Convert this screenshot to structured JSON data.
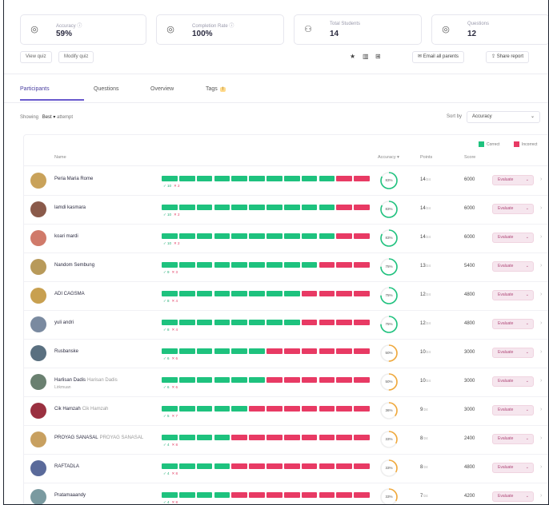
{
  "stats": [
    {
      "icon": "target-icon",
      "glyph": "◎",
      "label": "Accuracy ⓘ",
      "value": "59%"
    },
    {
      "icon": "completion-icon",
      "glyph": "◎",
      "label": "Completion Rate ⓘ",
      "value": "100%"
    },
    {
      "icon": "students-icon",
      "glyph": "⚇",
      "label": "Total Students",
      "value": "14"
    },
    {
      "icon": "questions-icon",
      "glyph": "◎",
      "label": "Questions",
      "value": "12"
    }
  ],
  "toolbar": {
    "chips": [
      "View quiz",
      "Modify quiz"
    ],
    "icons": [
      "★",
      "▥",
      "⊞"
    ],
    "email_button": "✉ Email all parents",
    "share_button": "⇪ Share report"
  },
  "tabs": [
    {
      "label": "Participants",
      "active": true
    },
    {
      "label": "Questions",
      "active": false
    },
    {
      "label": "Overview",
      "active": false
    },
    {
      "label": "Tags",
      "active": false,
      "badge": "!"
    }
  ],
  "filter": {
    "label": "Showing",
    "value": "Best ▾",
    "suffix": "attempt"
  },
  "sort": {
    "label": "Sort by",
    "value": "Accuracy",
    "caret": "⌄"
  },
  "legend": {
    "correct": "Correct",
    "incorrect": "Incorrect",
    "correct_color": "#1ec27e",
    "incorrect_color": "#e83a64"
  },
  "columns": {
    "name": "Name",
    "accuracy": "Accuracy ▾",
    "points": "Points",
    "score": "Score"
  },
  "participants": [
    {
      "name": "Peria Maria Rome",
      "alt": "",
      "sub": "",
      "correct": 10,
      "incorrect": 2,
      "correct_label": "✓ 10",
      "incorrect_label": "✕ 2",
      "accuracy": 83,
      "accuracy_label": "83%",
      "points": "14",
      "score": "6000",
      "avatar": "#c9a25a"
    },
    {
      "name": "lamdi kasmara",
      "alt": "",
      "sub": "",
      "correct": 10,
      "incorrect": 2,
      "correct_label": "✓ 10",
      "incorrect_label": "✕ 2",
      "accuracy": 83,
      "accuracy_label": "83%",
      "points": "14",
      "score": "6000",
      "avatar": "#8a5a4a"
    },
    {
      "name": "koari mardi",
      "alt": "",
      "sub": "",
      "correct": 10,
      "incorrect": 2,
      "correct_label": "✓ 10",
      "incorrect_label": "✕ 2",
      "accuracy": 83,
      "accuracy_label": "83%",
      "points": "14",
      "score": "6000",
      "avatar": "#d07a6a"
    },
    {
      "name": "Nandom Sembung",
      "alt": "",
      "sub": "",
      "correct": 9,
      "incorrect": 3,
      "correct_label": "✓ 9",
      "incorrect_label": "✕ 3",
      "accuracy": 75,
      "accuracy_label": "75%",
      "points": "13",
      "score": "5400",
      "avatar": "#b89a5a"
    },
    {
      "name": "ADI CAGSMA",
      "alt": "",
      "sub": "",
      "correct": 8,
      "incorrect": 4,
      "correct_label": "✓ 8",
      "incorrect_label": "✕ 4",
      "accuracy": 75,
      "accuracy_label": "75%",
      "points": "12",
      "score": "4800",
      "avatar": "#c8a050"
    },
    {
      "name": "yuli andri",
      "alt": "",
      "sub": "",
      "correct": 8,
      "incorrect": 4,
      "correct_label": "✓ 8",
      "incorrect_label": "✕ 4",
      "accuracy": 75,
      "accuracy_label": "75%",
      "points": "12",
      "score": "4800",
      "avatar": "#7a8aa0"
    },
    {
      "name": "Rusbanske",
      "alt": "",
      "sub": "",
      "correct": 6,
      "incorrect": 6,
      "correct_label": "✓ 6",
      "incorrect_label": "✕ 6",
      "accuracy": 50,
      "accuracy_label": "50%",
      "points": "10",
      "score": "3000",
      "avatar": "#5a7080"
    },
    {
      "name": "Harlisan Dadis",
      "alt": "Harisan Dadis",
      "sub": "Lirkmuan",
      "correct": 6,
      "incorrect": 6,
      "correct_label": "✓ 6",
      "incorrect_label": "✕ 6",
      "accuracy": 50,
      "accuracy_label": "50%",
      "points": "10",
      "score": "3000",
      "avatar": "#6a8070"
    },
    {
      "name": "Cik Hamzah",
      "alt": "Cik Hamzah",
      "sub": "",
      "correct": 5,
      "incorrect": 7,
      "correct_label": "✓ 5",
      "incorrect_label": "✕ 7",
      "accuracy": 36,
      "accuracy_label": "36%",
      "points": "9",
      "score": "3000",
      "avatar": "#9a3040"
    },
    {
      "name": "PROYAG SANASAL",
      "alt": "PROYAG SANASAL",
      "sub": "",
      "correct": 4,
      "incorrect": 8,
      "correct_label": "✓ 4",
      "incorrect_label": "✕ 8",
      "accuracy": 33,
      "accuracy_label": "33%",
      "points": "8",
      "score": "2400",
      "avatar": "#c8a060"
    },
    {
      "name": "RAFTADLA",
      "alt": "",
      "sub": "",
      "correct": 4,
      "incorrect": 8,
      "correct_label": "✓ 4",
      "incorrect_label": "✕ 8",
      "accuracy": 33,
      "accuracy_label": "33%",
      "points": "8",
      "score": "4800",
      "avatar": "#5a6a9a"
    },
    {
      "name": "Pratamaaandy",
      "alt": "",
      "sub": "",
      "correct": 4,
      "incorrect": 8,
      "correct_label": "✓ 4",
      "incorrect_label": "✕ 8",
      "accuracy": 33,
      "accuracy_label": "33%",
      "points": "7",
      "score": "4200",
      "avatar": "#7a9aa0"
    }
  ],
  "evaluate_label": "Evaluate",
  "evaluate_caret": "⌄",
  "points_unit": "/24",
  "row_more": "›"
}
